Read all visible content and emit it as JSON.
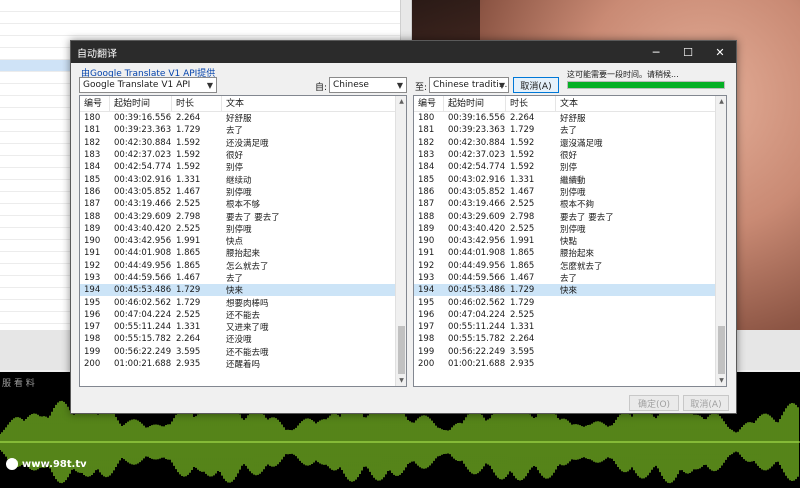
{
  "dialog": {
    "title": "自动翻译",
    "api_link": "由Google Translate V1 API提供",
    "api_select": "Google Translate V1 API",
    "from_label": "自:",
    "from_lang": "Chinese",
    "to_label": "至:",
    "to_lang": "Chinese traditi...",
    "cancel_top": "取消(A)",
    "status": "这可能需要一段时间。请稍候...",
    "progress": 1.0,
    "ok_button": "确定(O)",
    "cancel_button": "取消(A)"
  },
  "window_controls": {
    "minimize": "─",
    "maximize": "☐",
    "close": "✕"
  },
  "columns": {
    "num": "编号",
    "start": "起始时间",
    "dur": "时长",
    "text": "文本"
  },
  "rows": [
    {
      "n": "180",
      "s": "00:39:16.556",
      "d": "2.264",
      "src": "好舒服",
      "dst": "好舒服"
    },
    {
      "n": "181",
      "s": "00:39:23.363",
      "d": "1.729",
      "src": "去了",
      "dst": "去了"
    },
    {
      "n": "182",
      "s": "00:42:30.884",
      "d": "1.592",
      "src": "还没满足哦",
      "dst": "還沒滿足哦"
    },
    {
      "n": "183",
      "s": "00:42:37.023",
      "d": "1.592",
      "src": "很好",
      "dst": "很好"
    },
    {
      "n": "184",
      "s": "00:42:54.774",
      "d": "1.592",
      "src": "别停",
      "dst": "別停"
    },
    {
      "n": "185",
      "s": "00:43:02.916",
      "d": "1.331",
      "src": "继续动",
      "dst": "繼續動"
    },
    {
      "n": "186",
      "s": "00:43:05.852",
      "d": "1.467",
      "src": "别停哦",
      "dst": "別停哦"
    },
    {
      "n": "187",
      "s": "00:43:19.466",
      "d": "2.525",
      "src": "根本不够",
      "dst": "根本不夠"
    },
    {
      "n": "188",
      "s": "00:43:29.609",
      "d": "2.798",
      "src": "要去了 要去了",
      "dst": "要去了 要去了"
    },
    {
      "n": "189",
      "s": "00:43:40.420",
      "d": "2.525",
      "src": "别停哦",
      "dst": "別停哦"
    },
    {
      "n": "190",
      "s": "00:43:42.956",
      "d": "1.991",
      "src": "快点",
      "dst": "快點"
    },
    {
      "n": "191",
      "s": "00:44:01.908",
      "d": "1.865",
      "src": "腰抬起来",
      "dst": "腰抬起來"
    },
    {
      "n": "192",
      "s": "00:44:49.956",
      "d": "1.865",
      "src": "怎么就去了",
      "dst": "怎麼就去了"
    },
    {
      "n": "193",
      "s": "00:44:59.566",
      "d": "1.467",
      "src": "去了",
      "dst": "去了"
    },
    {
      "n": "194",
      "s": "00:45:53.486",
      "d": "1.729",
      "src": "快来",
      "dst": "快來"
    },
    {
      "n": "195",
      "s": "00:46:02.562",
      "d": "1.729",
      "src": "想要肉棒吗",
      "dst": ""
    },
    {
      "n": "196",
      "s": "00:47:04.224",
      "d": "2.525",
      "src": "还不能去",
      "dst": ""
    },
    {
      "n": "197",
      "s": "00:55:11.244",
      "d": "1.331",
      "src": "又进来了哦",
      "dst": ""
    },
    {
      "n": "198",
      "s": "00:55:15.782",
      "d": "2.264",
      "src": "还没哦",
      "dst": ""
    },
    {
      "n": "199",
      "s": "00:56:22.249",
      "d": "3.595",
      "src": "还不能去哦",
      "dst": ""
    },
    {
      "n": "200",
      "s": "01:00:21.688",
      "d": "2.935",
      "src": "还醒着吗",
      "dst": ""
    }
  ],
  "selected_row": "194",
  "background": {
    "timeline_label": "服 看 料",
    "watermark": "www.98t.tv"
  }
}
